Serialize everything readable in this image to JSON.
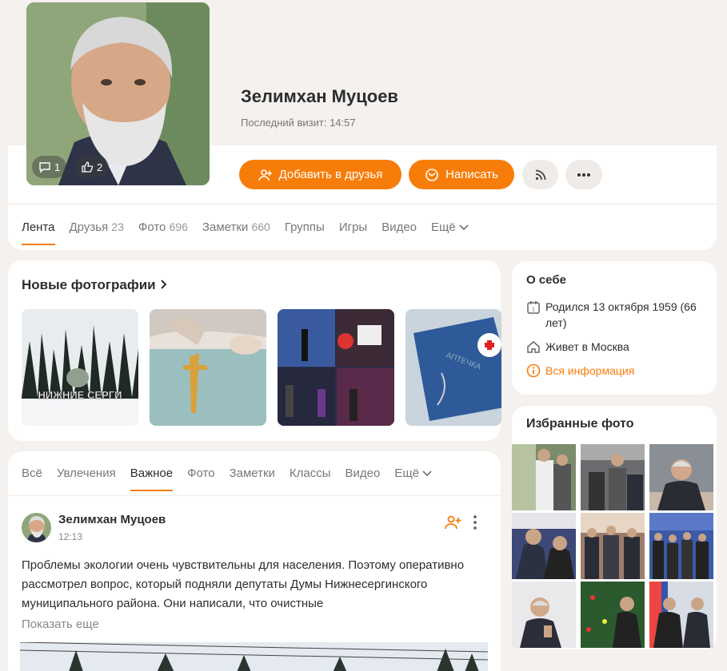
{
  "profile": {
    "name": "Зелимхан Муцоев",
    "last_visit": "Последний визит: 14:57",
    "avatar_comments": "1",
    "avatar_likes": "2"
  },
  "actions": {
    "add_friend": "Добавить в друзья",
    "write": "Написать"
  },
  "tabs": [
    {
      "label": "Лента",
      "count": ""
    },
    {
      "label": "Друзья",
      "count": "23"
    },
    {
      "label": "Фото",
      "count": "696"
    },
    {
      "label": "Заметки",
      "count": "660"
    },
    {
      "label": "Группы",
      "count": ""
    },
    {
      "label": "Игры",
      "count": ""
    },
    {
      "label": "Видео",
      "count": ""
    },
    {
      "label": "Ещё",
      "count": ""
    }
  ],
  "new_photos": {
    "title": "Новые фотографии",
    "sign_text": "НИЖНИЕ СЕРГИ",
    "kit_text": "АПТЕЧКА"
  },
  "about": {
    "title": "О себе",
    "born": "Родился 13 октября 1959 (66 лет)",
    "lives": "Живет в Москва",
    "all_info": "Вся информация"
  },
  "favorite_photos": {
    "title": "Избранные фото"
  },
  "feed": {
    "tabs": [
      "Всё",
      "Увлечения",
      "Важное",
      "Фото",
      "Заметки",
      "Классы",
      "Видео",
      "Ещё"
    ],
    "post": {
      "author": "Зелимхан Муцоев",
      "time": "12:13",
      "text": "Проблемы экологии очень чувствительны для населения. Поэтому оперативно рассмотрел вопрос, который подняли депутаты Думы Нижнесергинского муниципального района. Они написали, что очистные",
      "show_more": "Показать еще"
    }
  },
  "colors": {
    "accent": "#f77d0a",
    "background": "#f4f1ee"
  }
}
